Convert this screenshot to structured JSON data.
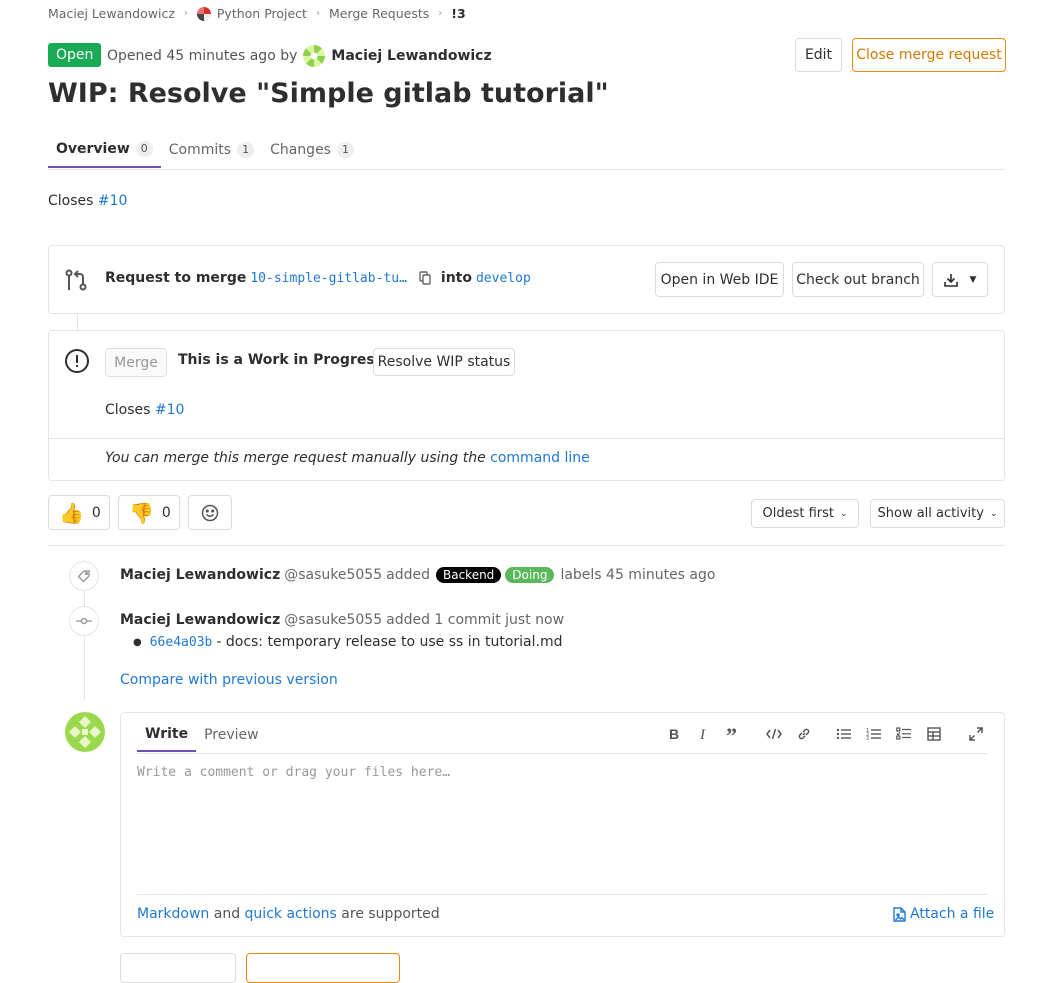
{
  "breadcrumb": {
    "items": [
      "Maciej Lewandowicz",
      "Python Project",
      "Merge Requests",
      "!3"
    ]
  },
  "header": {
    "status": "Open",
    "opened_prefix": "Opened 45 minutes ago by",
    "author": "Maciej Lewandowicz",
    "edit_label": "Edit",
    "close_label": "Close merge request",
    "title": "WIP: Resolve \"Simple gitlab tutorial\""
  },
  "tabs": [
    {
      "label": "Overview",
      "count": "0"
    },
    {
      "label": "Commits",
      "count": "1"
    },
    {
      "label": "Changes",
      "count": "1"
    }
  ],
  "description": {
    "prefix": "Closes",
    "issue": "#10"
  },
  "merge_widget": {
    "request_label": "Request to merge",
    "source_branch": "10-simple-gitlab-tu…",
    "into_label": "into",
    "target_branch": "develop",
    "web_ide_label": "Open in Web IDE",
    "checkout_label": "Check out branch",
    "merge_label": "Merge",
    "wip_text": "This is a Work in Progress",
    "resolve_wip_label": "Resolve WIP status",
    "closes_prefix": "Closes",
    "closes_issue": "#10",
    "manual_text": "You can merge this merge request manually using the",
    "command_line_label": "command line"
  },
  "awards": {
    "thumbs_up": "0",
    "thumbs_down": "0"
  },
  "sort": {
    "order_label": "Oldest first",
    "filter_label": "Show all activity"
  },
  "timeline": {
    "note1": {
      "author": "Maciej Lewandowicz",
      "handle": "@sasuke5055",
      "action": "added",
      "labels": [
        {
          "text": "Backend",
          "color": "#000000"
        },
        {
          "text": "Doing",
          "color": "#5cb85c"
        }
      ],
      "suffix": "labels 45 minutes ago"
    },
    "note2": {
      "author": "Maciej Lewandowicz",
      "handle": "@sasuke5055",
      "action": "added 1 commit just now",
      "commit_sha": "66e4a03b",
      "commit_msg": "- docs: temporary release to use ss in tutorial.md"
    },
    "compare_label": "Compare with previous version"
  },
  "comment": {
    "write_tab": "Write",
    "preview_tab": "Preview",
    "placeholder": "Write a comment or drag your files here…",
    "markdown_label": "Markdown",
    "and_text": "and",
    "quick_actions_label": "quick actions",
    "supported_text": "are supported",
    "attach_label": "Attach a file"
  },
  "colors": {
    "accent": "#6b4fbb",
    "link": "#1f78d1",
    "open": "#1aaa55",
    "warning": "#e78a0c"
  }
}
